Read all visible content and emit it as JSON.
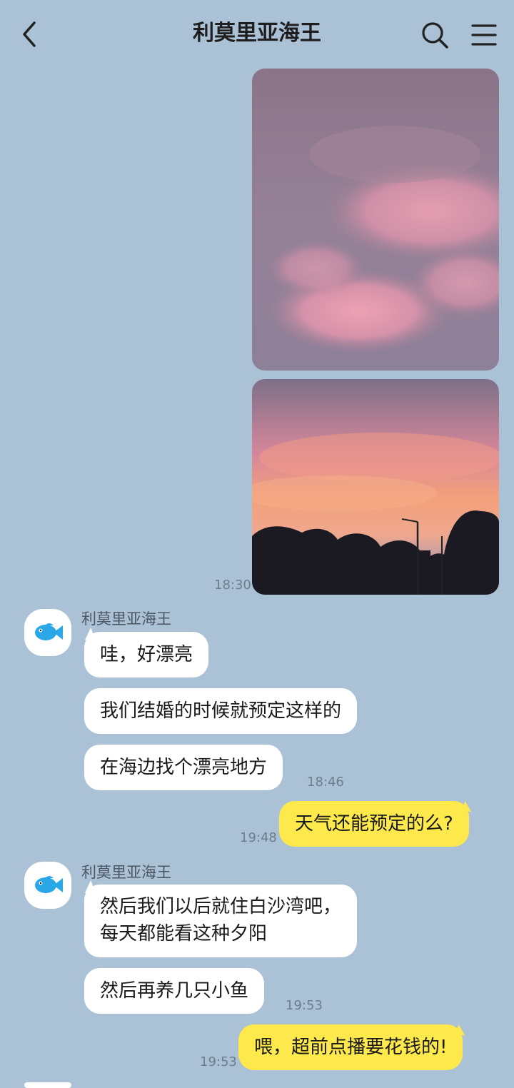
{
  "header": {
    "title": "利莫里亚海王",
    "back_icon": "chevron-left-icon",
    "search_icon": "search-icon",
    "menu_icon": "menu-icon"
  },
  "messages": {
    "photo_time": "18:30",
    "group1": {
      "sender": "利莫里亚海王",
      "avatar_icon": "fish-icon",
      "bubble1": "哇，好漂亮",
      "bubble2": "我们结婚的时候就预定这样的",
      "bubble3": "在海边找个漂亮地方",
      "time": "18:46"
    },
    "out1": {
      "text": "天气还能预定的么?",
      "time": "19:48"
    },
    "group2": {
      "sender": "利莫里亚海王",
      "avatar_icon": "fish-icon",
      "bubble1_line1": "然后我们以后就住白沙湾吧，",
      "bubble1_line2": "每天都能看这种夕阳",
      "bubble2": "然后再养几只小鱼",
      "time": "19:53"
    },
    "out2": {
      "text": "喂，超前点播要花钱的!",
      "time": "19:53"
    }
  },
  "colors": {
    "background": "#abc1d6",
    "outgoing_bubble": "#fde94b",
    "incoming_bubble": "#ffffff",
    "fish": "#2aa7e6"
  }
}
